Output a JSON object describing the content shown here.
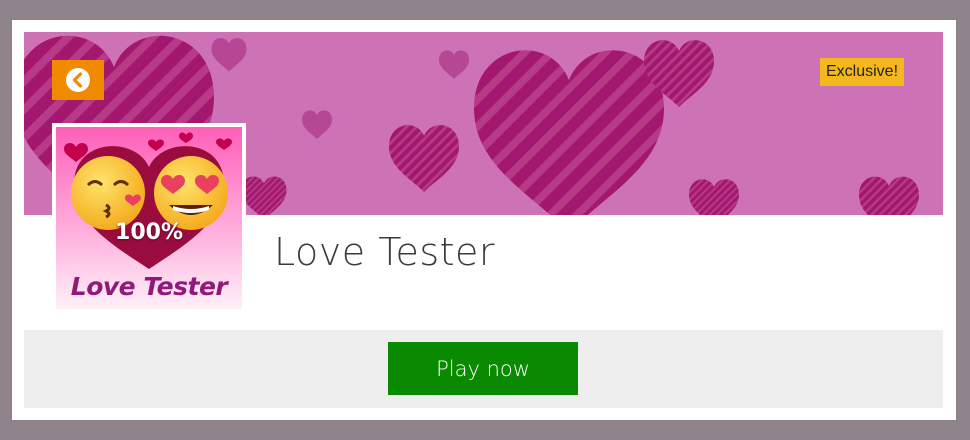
{
  "card": {
    "title": "Love Tester",
    "badge": "Exclusive!",
    "play_label": "Play now",
    "back_icon": "chevron-left-icon",
    "thumbnail": {
      "percent_text": "100%",
      "caption": "Love Tester"
    }
  },
  "colors": {
    "background": "#8f8489",
    "banner": "#cd73b5",
    "heart_dark": "#a3186e",
    "back_button": "#f08a00",
    "badge": "#f5b81c",
    "play_button": "#098a00",
    "play_bar": "#eeeeee"
  }
}
